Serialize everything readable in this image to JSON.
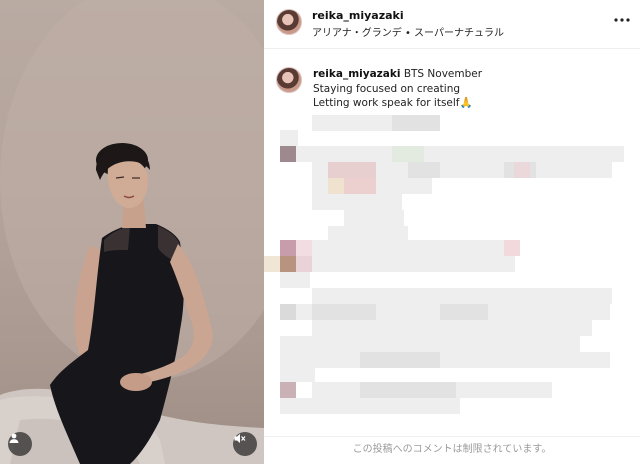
{
  "post": {
    "username": "reika_miyazaki",
    "audio": "アリアナ・グランデ • スーパーナチュラル",
    "caption_user": "reika_miyazaki",
    "caption_line1": "BTS November",
    "caption_line2": "Staying focused on creating",
    "caption_line3": "Letting work speak for itself🙏"
  },
  "comments": {
    "restricted_notice": "この投稿へのコメントは制限されています。"
  },
  "icons": {
    "more": "more-options-icon",
    "user_tag": "user-tag-icon",
    "mute": "mute-icon"
  }
}
